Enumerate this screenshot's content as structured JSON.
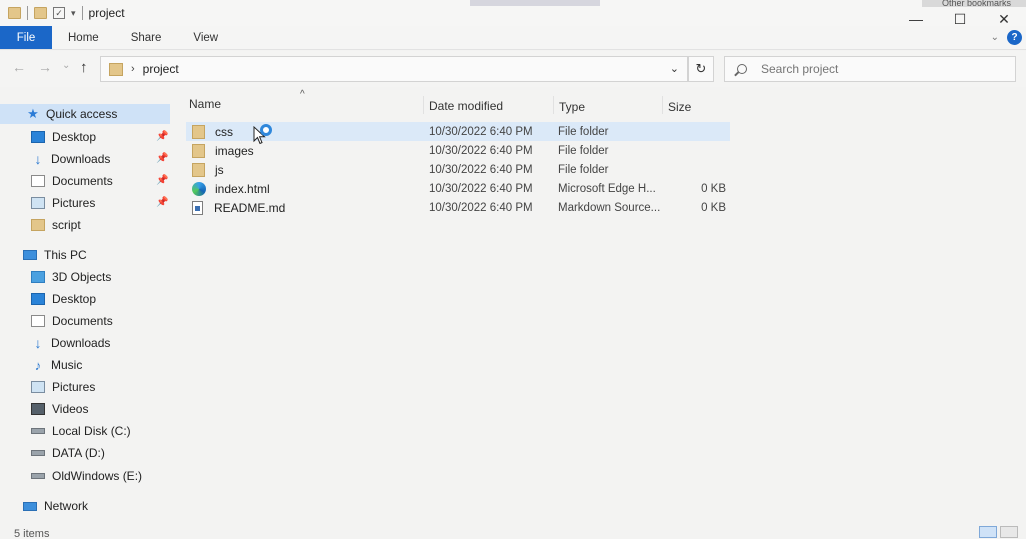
{
  "window": {
    "title": "project"
  },
  "bookmarks_fragment": "Other bookmarks",
  "window_controls": {
    "minimize": "—",
    "maximize": "☐",
    "close": "✕"
  },
  "ribbon": {
    "tabs": [
      "File",
      "Home",
      "Share",
      "View"
    ],
    "help": "?"
  },
  "nav": {
    "back": "←",
    "forward": "→",
    "recent": "⌄",
    "up": "↑"
  },
  "address": {
    "separator": "›",
    "path": "project",
    "dropdown": "⌄",
    "refresh": "↻"
  },
  "search": {
    "placeholder": "Search project"
  },
  "columns": {
    "name": "Name",
    "date": "Date modified",
    "type": "Type",
    "size": "Size",
    "sort_caret": "^"
  },
  "sidebar": {
    "quick_access": "Quick access",
    "quick_items": [
      {
        "label": "Desktop",
        "icon": "desktop-icon",
        "pinned": true
      },
      {
        "label": "Downloads",
        "icon": "downloads-icon",
        "pinned": true
      },
      {
        "label": "Documents",
        "icon": "documents-icon",
        "pinned": true
      },
      {
        "label": "Pictures",
        "icon": "pictures-icon",
        "pinned": true
      },
      {
        "label": "script",
        "icon": "folder-icon",
        "pinned": false
      }
    ],
    "this_pc": "This PC",
    "pc_items": [
      {
        "label": "3D Objects",
        "icon": "3d-objects-icon"
      },
      {
        "label": "Desktop",
        "icon": "desktop-icon"
      },
      {
        "label": "Documents",
        "icon": "documents-icon"
      },
      {
        "label": "Downloads",
        "icon": "downloads-icon"
      },
      {
        "label": "Music",
        "icon": "music-icon"
      },
      {
        "label": "Pictures",
        "icon": "pictures-icon"
      },
      {
        "label": "Videos",
        "icon": "videos-icon"
      },
      {
        "label": "Local Disk (C:)",
        "icon": "drive-icon"
      },
      {
        "label": "DATA (D:)",
        "icon": "drive-icon"
      },
      {
        "label": "OldWindows (E:)",
        "icon": "drive-icon"
      }
    ],
    "network": "Network",
    "pin_glyph": "📌"
  },
  "files": [
    {
      "name": "css",
      "date": "10/30/2022 6:40 PM",
      "type": "File folder",
      "size": "",
      "icon": "folder-icon",
      "selected": true
    },
    {
      "name": "images",
      "date": "10/30/2022 6:40 PM",
      "type": "File folder",
      "size": "",
      "icon": "folder-icon",
      "selected": false
    },
    {
      "name": "js",
      "date": "10/30/2022 6:40 PM",
      "type": "File folder",
      "size": "",
      "icon": "folder-icon",
      "selected": false
    },
    {
      "name": "index.html",
      "date": "10/30/2022 6:40 PM",
      "type": "Microsoft Edge H...",
      "size": "0 KB",
      "icon": "edge-html-icon",
      "selected": false
    },
    {
      "name": "README.md",
      "date": "10/30/2022 6:40 PM",
      "type": "Markdown Source...",
      "size": "0 KB",
      "icon": "markdown-file-icon",
      "selected": false
    }
  ],
  "status": {
    "item_count": "5 items"
  },
  "colors": {
    "accent": "#1b67c8",
    "selection": "#dbe9f8",
    "quick_access_bg": "#cfe2f7",
    "folder": "#e3c68a"
  }
}
